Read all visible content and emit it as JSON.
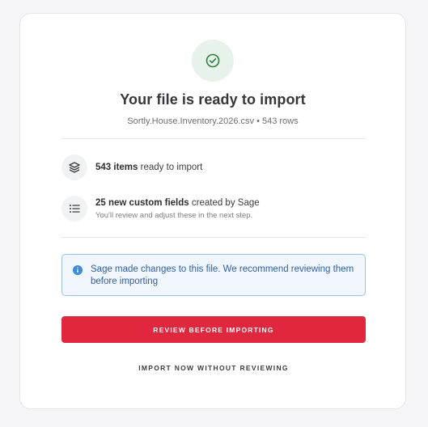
{
  "dialog": {
    "title": "Your file is ready to import",
    "subtitle": "Sortly.House.Inventory.2026.csv • 543 rows"
  },
  "summary": {
    "items_count": "543 items",
    "items_suffix": " ready to import",
    "fields_count": "25 new custom fields",
    "fields_suffix": " created by Sage",
    "fields_note": "You'll review and adjust these in the next step."
  },
  "notice": {
    "text": "Sage made changes to this file. We recommend reviewing them before importing"
  },
  "actions": {
    "review_label": "REVIEW BEFORE IMPORTING",
    "import_now_label": "IMPORT NOW WITHOUT REVIEWING"
  },
  "icons": {
    "status": "check-circle-icon",
    "items": "layers-icon",
    "fields": "list-icon",
    "notice": "info-icon"
  },
  "colors": {
    "success": "#2e7d43",
    "success_bg": "#e7f3ea",
    "primary": "#e0273d",
    "info": "#2d5fa6",
    "info_bg": "#f1f6fd",
    "info_border": "#9fbde6"
  }
}
